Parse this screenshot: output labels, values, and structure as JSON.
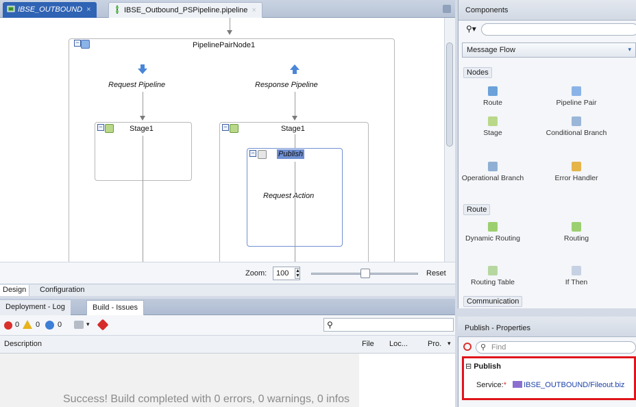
{
  "editor": {
    "tabs": [
      {
        "label": "IBSE_OUTBOUND",
        "close": "×"
      },
      {
        "label": "IBSE_Outbound_PSPipeline.pipeline",
        "close": "×"
      }
    ],
    "canvas": {
      "pair_node_title": "PipelinePairNode1",
      "request_pipeline": "Request Pipeline",
      "response_pipeline": "Response Pipeline",
      "stage_left": "Stage1",
      "stage_right": "Stage1",
      "publish_title": "Publish",
      "request_action": "Request Action"
    },
    "zoom": {
      "label": "Zoom:",
      "value": "100",
      "reset": "Reset",
      "level": 0.5
    },
    "bottom_tabs": [
      "Design",
      "Configuration"
    ]
  },
  "log": {
    "tabs": [
      "Deployment - Log",
      "Build - Issues"
    ],
    "counts": {
      "errors": "0",
      "warnings": "0",
      "infos": "0"
    },
    "columns": [
      "Description",
      "File",
      "Loc...",
      "Pro."
    ],
    "message": "Success!  Build completed with 0 errors, 0 warnings, 0 infos"
  },
  "components": {
    "title": "Components",
    "search_placeholder": "",
    "selected_palette": "Message Flow",
    "groups": [
      {
        "name": "Nodes",
        "items": [
          "Route",
          "Pipeline Pair",
          "Stage",
          "Conditional Branch",
          "Operational Branch",
          "Error Handler"
        ]
      },
      {
        "name": "Route",
        "items": [
          "Dynamic Routing",
          "Routing",
          "Routing Table",
          "If Then"
        ]
      },
      {
        "name": "Communication",
        "items": []
      }
    ]
  },
  "properties": {
    "title": "Publish - Properties",
    "find_placeholder": "Find",
    "section": "Publish",
    "service_label": "Service:",
    "required_marker": "*",
    "service_value": "IBSE_OUTBOUND/Fileout.biz"
  },
  "colors": {
    "accent": "#2f63b4",
    "highlight_border": "#e0141b",
    "selection": "#6f8fd1"
  }
}
